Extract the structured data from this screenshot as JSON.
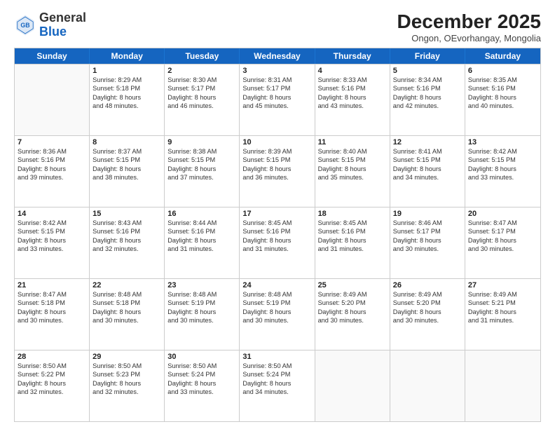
{
  "header": {
    "logo_general": "General",
    "logo_blue": "Blue",
    "month_title": "December 2025",
    "subtitle": "Ongon, OEvorhangay, Mongolia"
  },
  "weekdays": [
    "Sunday",
    "Monday",
    "Tuesday",
    "Wednesday",
    "Thursday",
    "Friday",
    "Saturday"
  ],
  "rows": [
    [
      {
        "day": "",
        "empty": true
      },
      {
        "day": "1",
        "lines": [
          "Sunrise: 8:29 AM",
          "Sunset: 5:18 PM",
          "Daylight: 8 hours",
          "and 48 minutes."
        ]
      },
      {
        "day": "2",
        "lines": [
          "Sunrise: 8:30 AM",
          "Sunset: 5:17 PM",
          "Daylight: 8 hours",
          "and 46 minutes."
        ]
      },
      {
        "day": "3",
        "lines": [
          "Sunrise: 8:31 AM",
          "Sunset: 5:17 PM",
          "Daylight: 8 hours",
          "and 45 minutes."
        ]
      },
      {
        "day": "4",
        "lines": [
          "Sunrise: 8:33 AM",
          "Sunset: 5:16 PM",
          "Daylight: 8 hours",
          "and 43 minutes."
        ]
      },
      {
        "day": "5",
        "lines": [
          "Sunrise: 8:34 AM",
          "Sunset: 5:16 PM",
          "Daylight: 8 hours",
          "and 42 minutes."
        ]
      },
      {
        "day": "6",
        "lines": [
          "Sunrise: 8:35 AM",
          "Sunset: 5:16 PM",
          "Daylight: 8 hours",
          "and 40 minutes."
        ]
      }
    ],
    [
      {
        "day": "7",
        "lines": [
          "Sunrise: 8:36 AM",
          "Sunset: 5:16 PM",
          "Daylight: 8 hours",
          "and 39 minutes."
        ]
      },
      {
        "day": "8",
        "lines": [
          "Sunrise: 8:37 AM",
          "Sunset: 5:15 PM",
          "Daylight: 8 hours",
          "and 38 minutes."
        ]
      },
      {
        "day": "9",
        "lines": [
          "Sunrise: 8:38 AM",
          "Sunset: 5:15 PM",
          "Daylight: 8 hours",
          "and 37 minutes."
        ]
      },
      {
        "day": "10",
        "lines": [
          "Sunrise: 8:39 AM",
          "Sunset: 5:15 PM",
          "Daylight: 8 hours",
          "and 36 minutes."
        ]
      },
      {
        "day": "11",
        "lines": [
          "Sunrise: 8:40 AM",
          "Sunset: 5:15 PM",
          "Daylight: 8 hours",
          "and 35 minutes."
        ]
      },
      {
        "day": "12",
        "lines": [
          "Sunrise: 8:41 AM",
          "Sunset: 5:15 PM",
          "Daylight: 8 hours",
          "and 34 minutes."
        ]
      },
      {
        "day": "13",
        "lines": [
          "Sunrise: 8:42 AM",
          "Sunset: 5:15 PM",
          "Daylight: 8 hours",
          "and 33 minutes."
        ]
      }
    ],
    [
      {
        "day": "14",
        "lines": [
          "Sunrise: 8:42 AM",
          "Sunset: 5:15 PM",
          "Daylight: 8 hours",
          "and 33 minutes."
        ]
      },
      {
        "day": "15",
        "lines": [
          "Sunrise: 8:43 AM",
          "Sunset: 5:16 PM",
          "Daylight: 8 hours",
          "and 32 minutes."
        ]
      },
      {
        "day": "16",
        "lines": [
          "Sunrise: 8:44 AM",
          "Sunset: 5:16 PM",
          "Daylight: 8 hours",
          "and 31 minutes."
        ]
      },
      {
        "day": "17",
        "lines": [
          "Sunrise: 8:45 AM",
          "Sunset: 5:16 PM",
          "Daylight: 8 hours",
          "and 31 minutes."
        ]
      },
      {
        "day": "18",
        "lines": [
          "Sunrise: 8:45 AM",
          "Sunset: 5:16 PM",
          "Daylight: 8 hours",
          "and 31 minutes."
        ]
      },
      {
        "day": "19",
        "lines": [
          "Sunrise: 8:46 AM",
          "Sunset: 5:17 PM",
          "Daylight: 8 hours",
          "and 30 minutes."
        ]
      },
      {
        "day": "20",
        "lines": [
          "Sunrise: 8:47 AM",
          "Sunset: 5:17 PM",
          "Daylight: 8 hours",
          "and 30 minutes."
        ]
      }
    ],
    [
      {
        "day": "21",
        "lines": [
          "Sunrise: 8:47 AM",
          "Sunset: 5:18 PM",
          "Daylight: 8 hours",
          "and 30 minutes."
        ]
      },
      {
        "day": "22",
        "lines": [
          "Sunrise: 8:48 AM",
          "Sunset: 5:18 PM",
          "Daylight: 8 hours",
          "and 30 minutes."
        ]
      },
      {
        "day": "23",
        "lines": [
          "Sunrise: 8:48 AM",
          "Sunset: 5:19 PM",
          "Daylight: 8 hours",
          "and 30 minutes."
        ]
      },
      {
        "day": "24",
        "lines": [
          "Sunrise: 8:48 AM",
          "Sunset: 5:19 PM",
          "Daylight: 8 hours",
          "and 30 minutes."
        ]
      },
      {
        "day": "25",
        "lines": [
          "Sunrise: 8:49 AM",
          "Sunset: 5:20 PM",
          "Daylight: 8 hours",
          "and 30 minutes."
        ]
      },
      {
        "day": "26",
        "lines": [
          "Sunrise: 8:49 AM",
          "Sunset: 5:20 PM",
          "Daylight: 8 hours",
          "and 30 minutes."
        ]
      },
      {
        "day": "27",
        "lines": [
          "Sunrise: 8:49 AM",
          "Sunset: 5:21 PM",
          "Daylight: 8 hours",
          "and 31 minutes."
        ]
      }
    ],
    [
      {
        "day": "28",
        "lines": [
          "Sunrise: 8:50 AM",
          "Sunset: 5:22 PM",
          "Daylight: 8 hours",
          "and 32 minutes."
        ]
      },
      {
        "day": "29",
        "lines": [
          "Sunrise: 8:50 AM",
          "Sunset: 5:23 PM",
          "Daylight: 8 hours",
          "and 32 minutes."
        ]
      },
      {
        "day": "30",
        "lines": [
          "Sunrise: 8:50 AM",
          "Sunset: 5:24 PM",
          "Daylight: 8 hours",
          "and 33 minutes."
        ]
      },
      {
        "day": "31",
        "lines": [
          "Sunrise: 8:50 AM",
          "Sunset: 5:24 PM",
          "Daylight: 8 hours",
          "and 34 minutes."
        ]
      },
      {
        "day": "",
        "empty": true
      },
      {
        "day": "",
        "empty": true
      },
      {
        "day": "",
        "empty": true
      }
    ]
  ]
}
